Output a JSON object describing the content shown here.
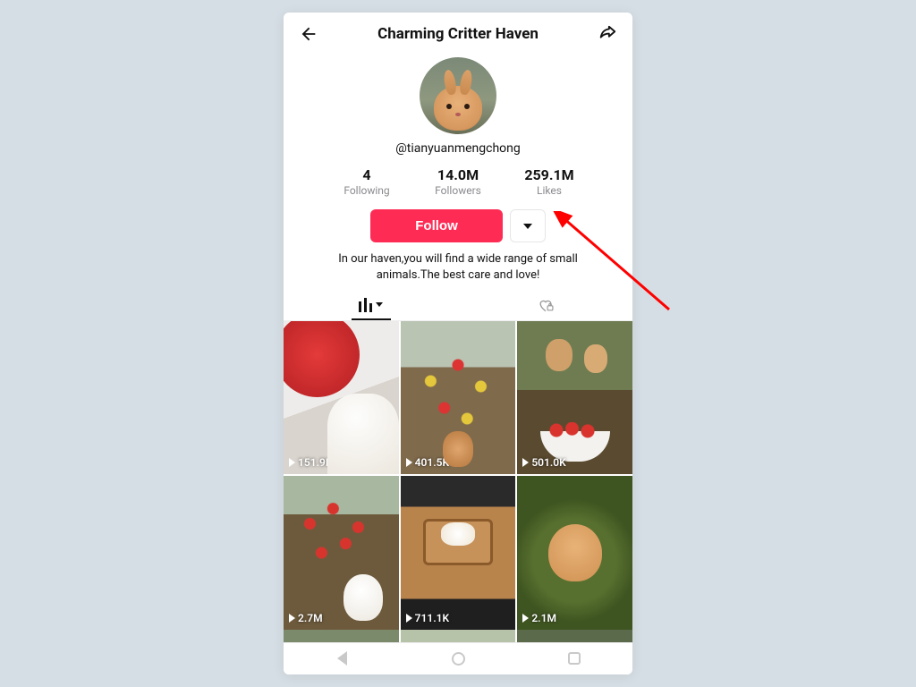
{
  "header": {
    "title": "Charming Critter Haven"
  },
  "profile": {
    "handle": "@tianyuanmengchong",
    "avatar_alt": "bunny-avatar"
  },
  "stats": {
    "following": {
      "value": "4",
      "label": "Following"
    },
    "followers": {
      "value": "14.0M",
      "label": "Followers"
    },
    "likes": {
      "value": "259.1M",
      "label": "Likes"
    }
  },
  "actions": {
    "follow_label": "Follow"
  },
  "bio": "In our haven,you will find a wide range of small animals.The best care and love!",
  "videos": [
    {
      "views": "151.9K"
    },
    {
      "views": "401.5K"
    },
    {
      "views": "501.0K"
    },
    {
      "views": "2.7M"
    },
    {
      "views": "711.1K"
    },
    {
      "views": "2.1M"
    }
  ],
  "colors": {
    "accent": "#fe2c55",
    "annotation": "#ff0000"
  }
}
